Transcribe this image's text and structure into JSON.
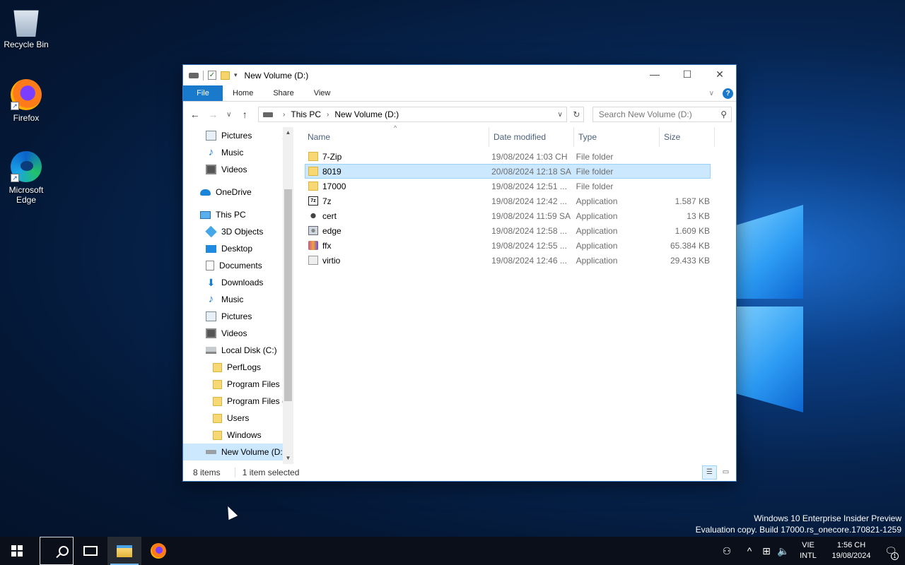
{
  "desktop": {
    "icons": [
      {
        "label": "Recycle Bin"
      },
      {
        "label": "Firefox"
      },
      {
        "label": "Microsoft Edge"
      }
    ],
    "watermark": {
      "line1": "Windows 10 Enterprise Insider Preview",
      "line2": "Evaluation copy. Build 17000.rs_onecore.170821-1259"
    }
  },
  "window": {
    "title": "New Volume (D:)",
    "controls": {
      "minimize": "—",
      "maximize": "☐",
      "close": "✕"
    },
    "ribbon_tabs": [
      "File",
      "Home",
      "Share",
      "View"
    ],
    "address": {
      "segments": [
        "This PC",
        "New Volume (D:)"
      ]
    },
    "search": {
      "placeholder": "Search New Volume (D:)"
    },
    "nav_pane": {
      "items": [
        {
          "label": "Pictures",
          "icon": "pictures-icon",
          "pinned": true
        },
        {
          "label": "Music",
          "icon": "music-icon"
        },
        {
          "label": "Videos",
          "icon": "videos-icon"
        },
        {
          "label": "OneDrive",
          "icon": "onedrive-icon"
        },
        {
          "label": "This PC",
          "icon": "this-pc-icon"
        },
        {
          "label": "3D Objects",
          "icon": "3d-objects-icon"
        },
        {
          "label": "Desktop",
          "icon": "desktop-icon"
        },
        {
          "label": "Documents",
          "icon": "documents-icon"
        },
        {
          "label": "Downloads",
          "icon": "downloads-icon"
        },
        {
          "label": "Music",
          "icon": "music-icon"
        },
        {
          "label": "Pictures",
          "icon": "pictures-icon"
        },
        {
          "label": "Videos",
          "icon": "videos-icon"
        },
        {
          "label": "Local Disk (C:)",
          "icon": "local-disk-icon"
        },
        {
          "label": "PerfLogs",
          "icon": "folder-icon"
        },
        {
          "label": "Program Files",
          "icon": "folder-icon"
        },
        {
          "label": "Program Files (",
          "icon": "folder-icon"
        },
        {
          "label": "Users",
          "icon": "folder-icon"
        },
        {
          "label": "Windows",
          "icon": "folder-icon"
        },
        {
          "label": "New Volume (D:",
          "icon": "drive-icon",
          "selected": true
        }
      ]
    },
    "columns": {
      "name": "Name",
      "date": "Date modified",
      "type": "Type",
      "size": "Size"
    },
    "files": [
      {
        "name": "7-Zip",
        "date": "19/08/2024 1:03 CH",
        "type": "File folder",
        "size": "",
        "icon": "folder-icon"
      },
      {
        "name": "8019",
        "date": "20/08/2024 12:18 SA",
        "type": "File folder",
        "size": "",
        "icon": "folder-icon",
        "selected": true
      },
      {
        "name": "17000",
        "date": "19/08/2024 12:51 ...",
        "type": "File folder",
        "size": "",
        "icon": "folder-icon"
      },
      {
        "name": "7z",
        "date": "19/08/2024 12:42 ...",
        "type": "Application",
        "size": "1.587 KB",
        "icon": "7z-app-icon"
      },
      {
        "name": "cert",
        "date": "19/08/2024 11:59 SA",
        "type": "Application",
        "size": "13 KB",
        "icon": "cert-app-icon"
      },
      {
        "name": "edge",
        "date": "19/08/2024 12:58 ...",
        "type": "Application",
        "size": "1.609 KB",
        "icon": "edge-app-icon"
      },
      {
        "name": "ffx",
        "date": "19/08/2024 12:55 ...",
        "type": "Application",
        "size": "65.384 KB",
        "icon": "ffx-app-icon"
      },
      {
        "name": "virtio",
        "date": "19/08/2024 12:46 ...",
        "type": "Application",
        "size": "29.433 KB",
        "icon": "virtio-app-icon"
      }
    ],
    "status": {
      "count": "8 items",
      "selection": "1 item selected"
    }
  },
  "taskbar": {
    "lang_line1": "VIE",
    "lang_line2": "INTL",
    "time": "1:56 CH",
    "date": "19/08/2024",
    "notif_count": "1"
  }
}
